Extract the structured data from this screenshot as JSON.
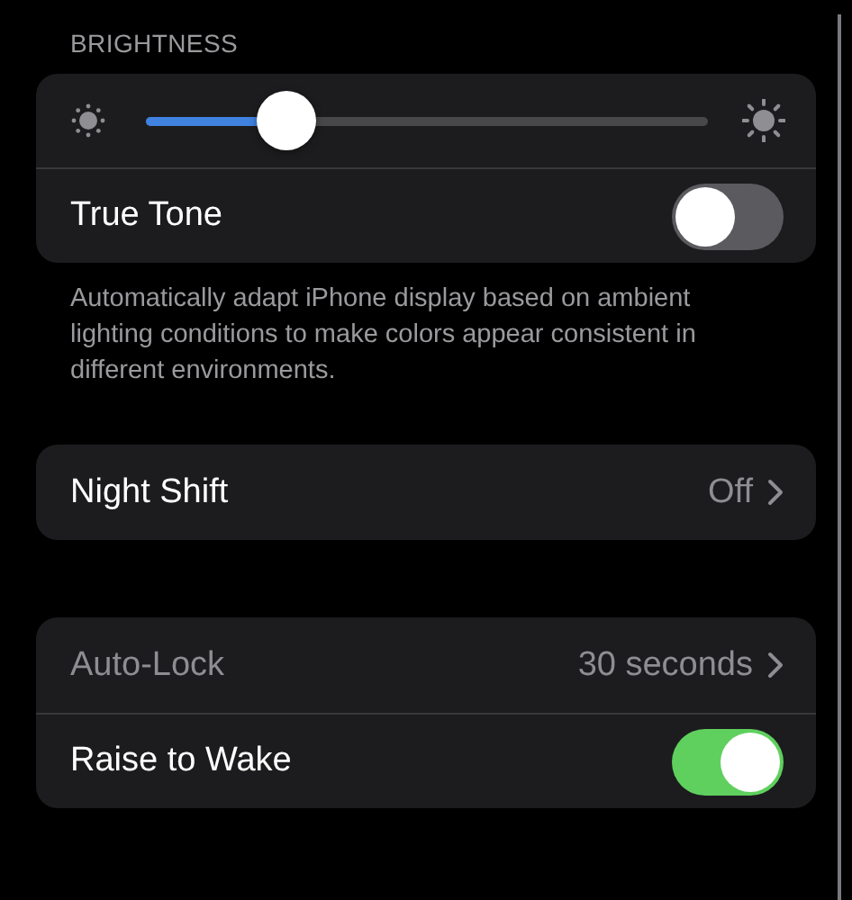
{
  "brightness": {
    "header": "BRIGHTNESS",
    "level": 0.25
  },
  "true_tone": {
    "label": "True Tone",
    "on": false
  },
  "description": "Automatically adapt iPhone display based on ambient lighting conditions to make colors appear consistent in different environments.",
  "night_shift": {
    "label": "Night Shift",
    "value": "Off"
  },
  "lock_group": [
    {
      "kind": "link",
      "label": "Auto-Lock",
      "value": "30 seconds",
      "disabled": true
    },
    {
      "kind": "toggle",
      "label": "Raise to Wake",
      "on": true
    }
  ]
}
